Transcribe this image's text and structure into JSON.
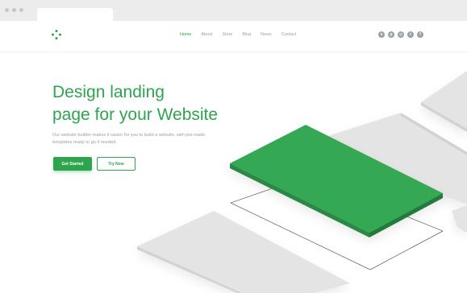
{
  "nav": {
    "links": [
      {
        "label": "Home",
        "active": true
      },
      {
        "label": "About"
      },
      {
        "label": "Store"
      },
      {
        "label": "Blog"
      },
      {
        "label": "News"
      },
      {
        "label": "Contact"
      }
    ],
    "socials": [
      "vimeo-icon",
      "pinterest-icon",
      "instagram-icon",
      "twitter-icon",
      "facebook-icon"
    ]
  },
  "hero": {
    "title_line1": "Design landing",
    "title_line2": "page for your Website",
    "subtitle": "Our website builder makes it easier for you to build a website, with pre-made templates ready to go if needed.",
    "primary_button": "Get Started",
    "secondary_button": "Try Now"
  },
  "colors": {
    "accent": "#2ea44f",
    "muted": "#9aa0a6",
    "card_grey": "#dcdcdc"
  }
}
